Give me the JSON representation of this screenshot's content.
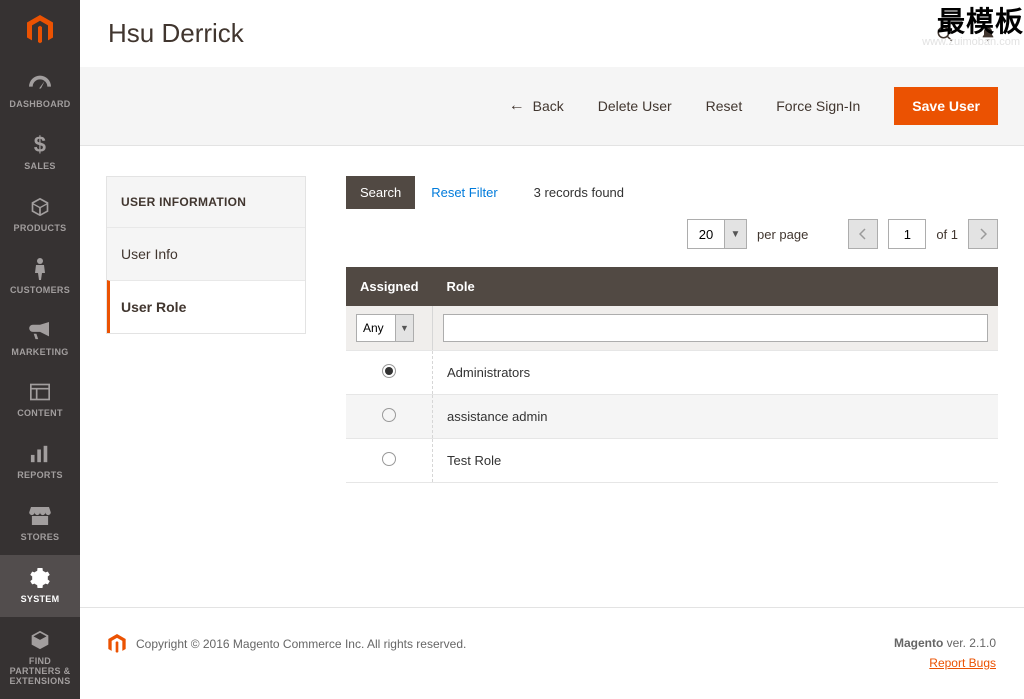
{
  "watermark": {
    "text": "最模板",
    "url": "www.zuimoban.com"
  },
  "header": {
    "title": "Hsu Derrick"
  },
  "sidebar": {
    "items": [
      {
        "label": "DASHBOARD",
        "icon": "gauge"
      },
      {
        "label": "SALES",
        "icon": "dollar"
      },
      {
        "label": "PRODUCTS",
        "icon": "cube"
      },
      {
        "label": "CUSTOMERS",
        "icon": "person"
      },
      {
        "label": "MARKETING",
        "icon": "megaphone"
      },
      {
        "label": "CONTENT",
        "icon": "layout"
      },
      {
        "label": "REPORTS",
        "icon": "bars"
      },
      {
        "label": "STORES",
        "icon": "storefront"
      },
      {
        "label": "SYSTEM",
        "icon": "gear"
      },
      {
        "label": "FIND PARTNERS & EXTENSIONS",
        "icon": "package"
      }
    ],
    "active_index": 8
  },
  "actions": {
    "back": "Back",
    "delete": "Delete User",
    "reset": "Reset",
    "force_signin": "Force Sign-In",
    "save": "Save User"
  },
  "left_panel": {
    "title": "USER INFORMATION",
    "items": [
      "User Info",
      "User Role"
    ],
    "active_index": 1
  },
  "grid": {
    "search": "Search",
    "reset_filter": "Reset Filter",
    "records_text": "3 records found",
    "per_page_value": "20",
    "per_page_label": "per page",
    "page_value": "1",
    "page_total": "of 1",
    "columns": {
      "assigned": "Assigned",
      "role": "Role"
    },
    "filter_assigned": "Any",
    "filter_role": "",
    "rows": [
      {
        "assigned": true,
        "role": "Administrators"
      },
      {
        "assigned": false,
        "role": "assistance admin"
      },
      {
        "assigned": false,
        "role": "Test Role"
      }
    ]
  },
  "footer": {
    "copyright": "Copyright © 2016 Magento Commerce Inc. All rights reserved.",
    "brand": "Magento",
    "version": " ver. 2.1.0",
    "report": "Report Bugs"
  }
}
